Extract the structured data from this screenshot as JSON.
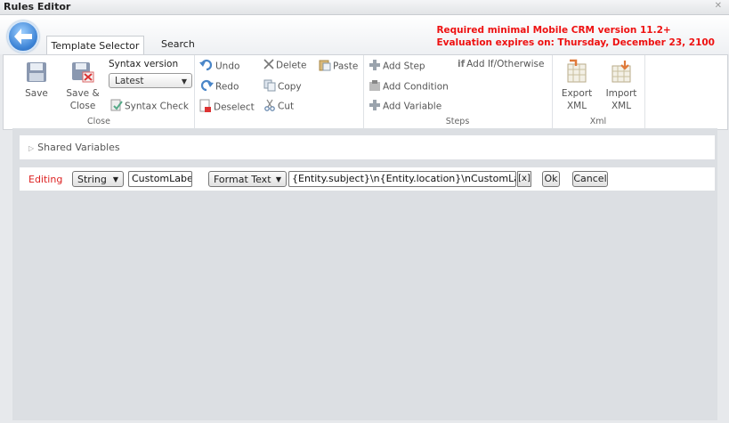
{
  "window": {
    "title": "Rules Editor",
    "close_glyph": "✕"
  },
  "header": {
    "tabs": [
      {
        "label": "Template Selector"
      },
      {
        "label": "Search"
      }
    ],
    "notice_line1": "Required minimal Mobile CRM version 11.2+",
    "notice_line2": "Evaluation expires on: Thursday, December 23, 2100"
  },
  "ribbon": {
    "close_group": {
      "label": "Close",
      "save": "Save",
      "save_close_1": "Save &",
      "save_close_2": "Close",
      "syntax_version_label": "Syntax version",
      "syntax_version_value": "Latest",
      "syntax_check": "Syntax Check"
    },
    "edit_group": {
      "undo": "Undo",
      "redo": "Redo",
      "deselect": "Deselect",
      "delete": "Delete",
      "copy": "Copy",
      "cut": "Cut",
      "paste": "Paste"
    },
    "steps_group": {
      "label": "Steps",
      "add_step": "Add Step",
      "add_condition": "Add Condition",
      "add_variable": "Add Variable",
      "add_if": "Add If/Otherwise",
      "if_glyph": "if"
    },
    "xml_group": {
      "label": "Xml",
      "export_1": "Export",
      "export_2": "XML",
      "import_1": "Import",
      "import_2": "XML"
    }
  },
  "shared_variables": {
    "label": "Shared Variables"
  },
  "editor_row": {
    "editing_label": "Editing",
    "type_value": "String",
    "name_value": "CustomLabel",
    "function_value": "Format Text",
    "expression_value": "{Entity.subject}\\n{Entity.location}\\nCustomLabel",
    "x_button": "[x]",
    "ok_button": "Ok",
    "cancel_button": "Cancel"
  },
  "colors": {
    "accent_red": "#e11111",
    "editing_red": "#dd2222",
    "back_blue": "#3d84d6"
  }
}
